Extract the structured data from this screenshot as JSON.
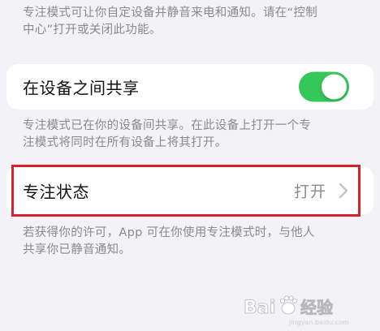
{
  "top_footnote": {
    "line1": "专注模式可让你自定设备并静音来电和通知。请在“控制",
    "line2": "中心”打开或关闭此功能。"
  },
  "share_row": {
    "label": "在设备之间共享",
    "toggle_on": true,
    "toggle_color": "#34c759"
  },
  "share_footnote": {
    "line1": "专注模式已在你的设备间共享。在此设备上打开一个专",
    "line2": "注模式将同时在所有设备上将其打开。"
  },
  "focus_status_row": {
    "label": "专注状态",
    "value": "打开",
    "highlight_color": "#d6202a"
  },
  "status_footnote": {
    "line1": "若获得你的许可，App 可在你使用专注模式时，与他人",
    "line2": "共享你已静音通知。"
  },
  "watermark": {
    "text": "Bai 经验",
    "sub": "jingyan.baidu.com"
  }
}
